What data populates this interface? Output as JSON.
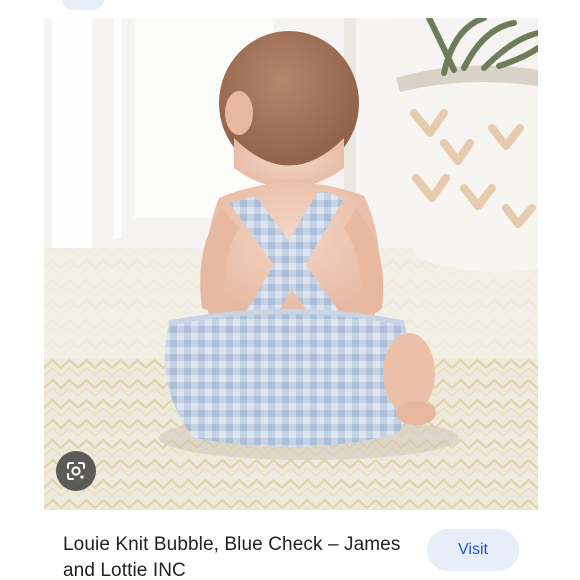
{
  "result": {
    "title": "Louie Knit Bubble, Blue Check – James and Lottie INC",
    "visit_label": "Visit"
  },
  "icons": {
    "lens": "google-lens-icon"
  },
  "colors": {
    "button_bg": "#e8eef9",
    "button_text": "#1a56c4",
    "title_text": "#202124",
    "lens_bg": "#3c3c3c"
  }
}
